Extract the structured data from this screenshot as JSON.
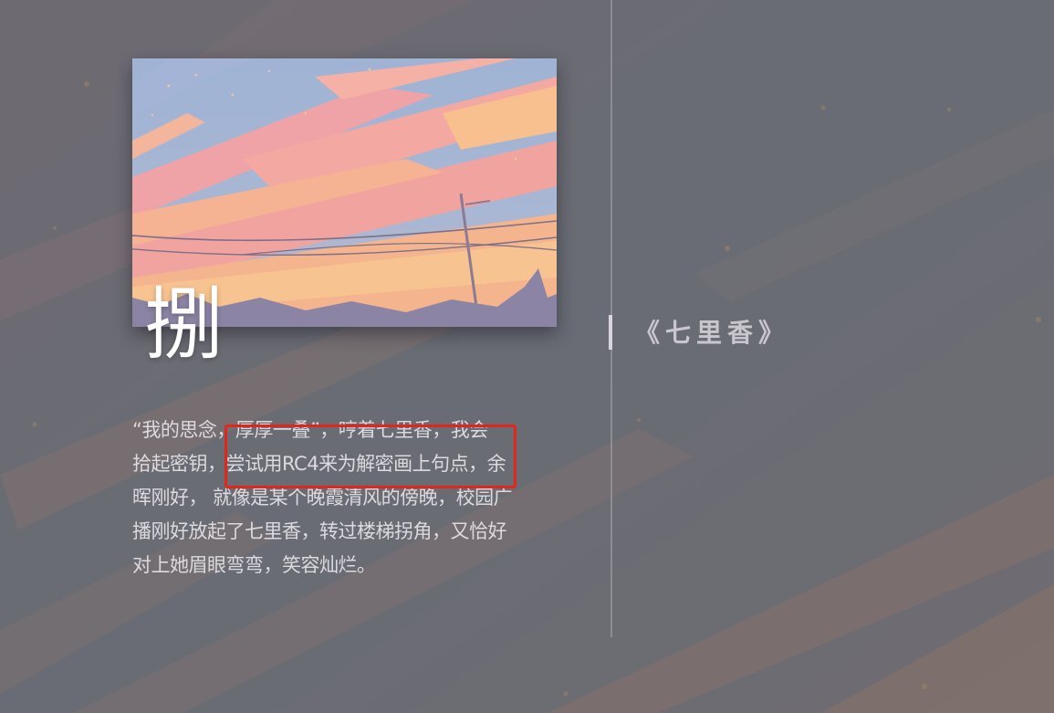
{
  "card": {
    "image_name": "anime-sunset-sky-illustration",
    "heading_char": "捌",
    "paragraph_lines": [
      "“我的思念，厚厚一叠”，哼着七里香，我会",
      "拾起密钥，尝试用RC4来为解密画上句点，余",
      "晖刚好， 就像是某个晚霞清风的傍晚，校园广",
      "播刚好放起了七里香，转过楼梯拐角，又恰好",
      "对上她眉眼弯弯，笑容灿烂。"
    ]
  },
  "side": {
    "song_title": "《七里香》"
  },
  "colors": {
    "background": "#6a6d75",
    "highlight": "#e1261c",
    "text": "#dcdadf"
  }
}
